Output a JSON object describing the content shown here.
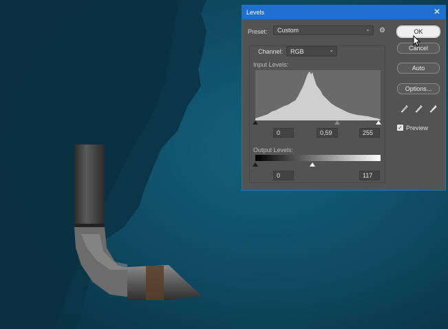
{
  "dialog": {
    "title": "Levels",
    "preset": {
      "label": "Preset:",
      "value": "Custom"
    },
    "channel": {
      "label": "Channel:",
      "value": "RGB"
    },
    "input_levels": {
      "label": "Input Levels:",
      "black": "0",
      "gamma": "0,59",
      "white": "255"
    },
    "output_levels": {
      "label": "Output Levels:",
      "black": "0",
      "white": "117"
    },
    "buttons": {
      "ok": "OK",
      "cancel": "Cancel",
      "auto": "Auto",
      "options": "Options..."
    },
    "preview": {
      "label": "Preview",
      "checked": true
    }
  },
  "icons": {
    "close": "close-icon",
    "gear": "gear-icon",
    "eyedroppers": [
      "black-point-eyedropper-icon",
      "gray-point-eyedropper-icon",
      "white-point-eyedropper-icon"
    ]
  },
  "colors": {
    "titlebar": "#1e6fd0",
    "dialog_bg": "#535353",
    "canvas_bg": "#0d3d52"
  }
}
